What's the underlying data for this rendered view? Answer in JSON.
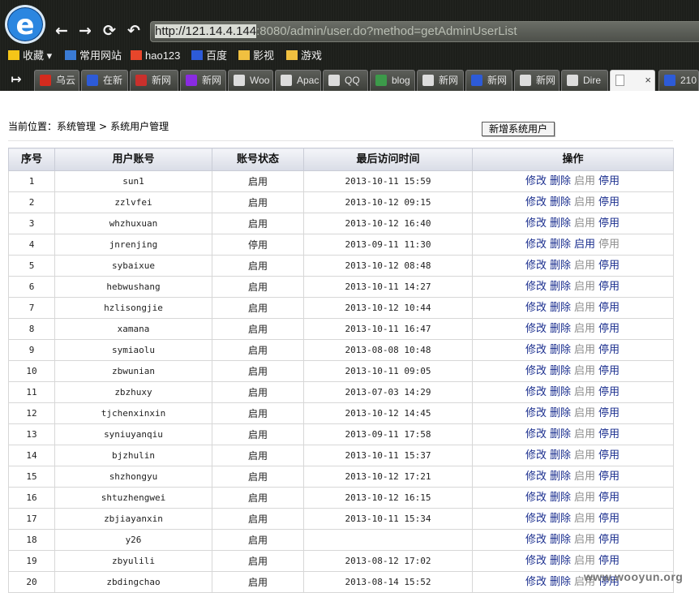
{
  "browser": {
    "logo_letter": "e",
    "address": {
      "host": "http://121.14.4.144",
      "rest": ":8080/admin/user.do?method=getAdminUserList"
    },
    "nav_icons": [
      "back-arrow-icon",
      "forward-arrow-icon",
      "refresh-icon",
      "undo-icon"
    ],
    "bookmarks": [
      {
        "label": "收藏 ▾",
        "icon": "star-icon",
        "color": "#f5c518"
      },
      {
        "label": "常用网站",
        "icon": "grid-icon",
        "color": "#3a7bd5"
      },
      {
        "label": "hao123",
        "icon": "hao123-icon",
        "color": "#e8462b"
      },
      {
        "label": "百度",
        "icon": "baidu-paw-icon",
        "color": "#2d5bd8"
      },
      {
        "label": "影视",
        "icon": "folder-icon",
        "color": "#f0c040"
      },
      {
        "label": "游戏",
        "icon": "folder-icon",
        "color": "#f0c040"
      }
    ],
    "tabs": [
      {
        "label": "乌云",
        "icon_color": "#d52b1e"
      },
      {
        "label": "在新",
        "icon_color": "#2d5bd8"
      },
      {
        "label": "新网",
        "icon_color": "#c9302c"
      },
      {
        "label": "新网",
        "icon_color": "#8a2be2"
      },
      {
        "label": "Woo",
        "icon_color": "#dcdcdc"
      },
      {
        "label": "Apac",
        "icon_color": "#dcdcdc"
      },
      {
        "label": "QQ",
        "icon_color": "#dcdcdc"
      },
      {
        "label": "blog",
        "icon_color": "#3c9a4a"
      },
      {
        "label": "新网",
        "icon_color": "#dcdcdc"
      },
      {
        "label": "新网",
        "icon_color": "#2d5bd8"
      },
      {
        "label": "新网",
        "icon_color": "#dcdcdc"
      },
      {
        "label": "Dire",
        "icon_color": "#dcdcdc"
      },
      {
        "label": "",
        "icon_color": "#ffffff",
        "active": true
      },
      {
        "label": "210",
        "icon_color": "#2d5bd8"
      }
    ],
    "tab_close": "×",
    "sidebar_toggle": "↦"
  },
  "page": {
    "breadcrumb": {
      "prefix": "当前位置：",
      "section": "系统管理",
      "sep": ">",
      "current": "系统用户管理"
    },
    "add_button": "新增系统用户",
    "table": {
      "headers": [
        "序号",
        "用户账号",
        "账号状态",
        "最后访问时间",
        "操作"
      ],
      "actions": {
        "edit": "修改",
        "delete": "删除",
        "enable": "启用",
        "disable": "停用"
      },
      "rows": [
        {
          "no": "1",
          "account": "sun1",
          "status": "启用",
          "last": "2013-10-11 15:59"
        },
        {
          "no": "2",
          "account": "zzlvfei",
          "status": "启用",
          "last": "2013-10-12 09:15"
        },
        {
          "no": "3",
          "account": "whzhuxuan",
          "status": "启用",
          "last": "2013-10-12 16:40"
        },
        {
          "no": "4",
          "account": "jnrenjing",
          "status": "停用",
          "last": "2013-09-11 11:30"
        },
        {
          "no": "5",
          "account": "sybaixue",
          "status": "启用",
          "last": "2013-10-12 08:48"
        },
        {
          "no": "6",
          "account": "hebwushang",
          "status": "启用",
          "last": "2013-10-11 14:27"
        },
        {
          "no": "7",
          "account": "hzlisongjie",
          "status": "启用",
          "last": "2013-10-12 10:44"
        },
        {
          "no": "8",
          "account": "xamana",
          "status": "启用",
          "last": "2013-10-11 16:47"
        },
        {
          "no": "9",
          "account": "symiaolu",
          "status": "启用",
          "last": "2013-08-08 10:48"
        },
        {
          "no": "10",
          "account": "zbwunian",
          "status": "启用",
          "last": "2013-10-11 09:05"
        },
        {
          "no": "11",
          "account": "zbzhuxy",
          "status": "启用",
          "last": "2013-07-03 14:29"
        },
        {
          "no": "12",
          "account": "tjchenxinxin",
          "status": "启用",
          "last": "2013-10-12 14:45"
        },
        {
          "no": "13",
          "account": "syniuyanqiu",
          "status": "启用",
          "last": "2013-09-11 17:58"
        },
        {
          "no": "14",
          "account": "bjzhulin",
          "status": "启用",
          "last": "2013-10-11 15:37"
        },
        {
          "no": "15",
          "account": "shzhongyu",
          "status": "启用",
          "last": "2013-10-12 17:21"
        },
        {
          "no": "16",
          "account": "shtuzhengwei",
          "status": "启用",
          "last": "2013-10-12 16:15"
        },
        {
          "no": "17",
          "account": "zbjiayanxin",
          "status": "启用",
          "last": "2013-10-11 15:34"
        },
        {
          "no": "18",
          "account": "y26",
          "status": "启用",
          "last": ""
        },
        {
          "no": "19",
          "account": "zbyulili",
          "status": "启用",
          "last": "2013-08-12 17:02"
        },
        {
          "no": "20",
          "account": "zbdingchao",
          "status": "启用",
          "last": "2013-08-14 15:52"
        }
      ]
    }
  },
  "watermark": "www.wooyun.org"
}
